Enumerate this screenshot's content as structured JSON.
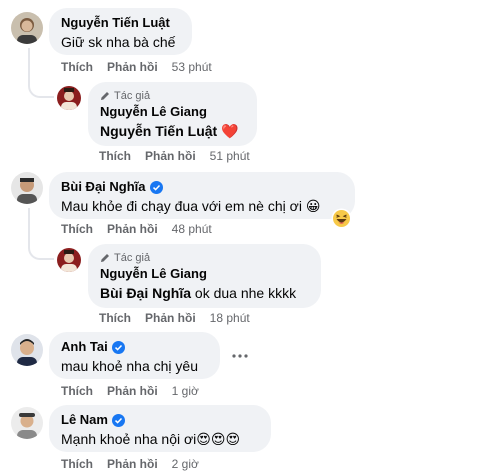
{
  "comments": [
    {
      "author": "Nguyễn Tiến Luật",
      "text": "Giữ sk nha bà chế",
      "like": "Thích",
      "reply": "Phản hồi",
      "time": "53 phút"
    },
    {
      "author_badge": "Tác giả",
      "author": "Nguyễn Lê Giang",
      "mention": "Nguyễn Tiến Luật",
      "text": "",
      "emoji": "❤️",
      "like": "Thích",
      "reply": "Phản hồi",
      "time": "51 phút"
    },
    {
      "author": "Bùi Đại Nghĩa",
      "text": "Mau khỏe đi chạy đua với em nè chị ơi",
      "emoji": "😀",
      "like": "Thích",
      "reply": "Phản hồi",
      "time": "48 phút"
    },
    {
      "author_badge": "Tác giả",
      "author": "Nguyễn Lê Giang",
      "mention": "Bùi Đại Nghĩa",
      "text": " ok dua nhe kkkk",
      "like": "Thích",
      "reply": "Phản hồi",
      "time": "18 phút"
    },
    {
      "author": "Anh Tai",
      "text": "mau khoẻ nha chị yêu",
      "like": "Thích",
      "reply": "Phản hồi",
      "time": "1 giờ"
    },
    {
      "author": "Lê Nam",
      "text": "Mạnh khoẻ nha nội ơi",
      "emoji": "😍😍😍",
      "like": "Thích",
      "reply": "Phản hồi",
      "time": "2 giờ"
    }
  ],
  "icons": {
    "verified": "verified-badge-icon",
    "author_badge": "pen-icon",
    "more": "more-options-icon",
    "reaction": "haha-reaction-icon"
  },
  "colors": {
    "bubble": "#f0f2f5",
    "meta": "#65676b",
    "verified": "#1877f2",
    "heart": "#e41e3f"
  }
}
